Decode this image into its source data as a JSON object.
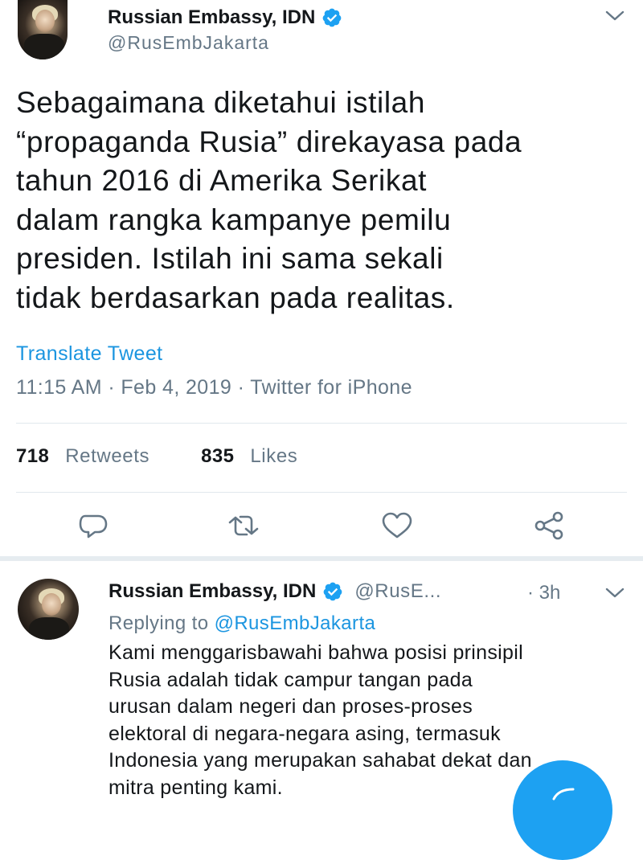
{
  "tweet": {
    "author_name": "Russian Embassy, IDN",
    "author_handle": "@RusEmbJakarta",
    "text_lines": [
      "Sebagaimana diketahui istilah",
      "“propaganda Rusia” direkayasa pada",
      "tahun 2016 di Amerika Serikat",
      "dalam rangka kampanye pemilu",
      "presiden. Istilah ini sama sekali",
      "tidak berdasarkan pada realitas."
    ],
    "translate_label": "Translate Tweet",
    "meta": "11:15 AM · Feb 4, 2019 · Twitter for iPhone",
    "retweet_count": "718",
    "retweet_label": "Retweets",
    "like_count": "835",
    "like_label": "Likes"
  },
  "reply": {
    "author_name": "Russian Embassy, IDN",
    "author_handle": "@RusE...",
    "time": "· 3h",
    "replying_prefix": "Replying to",
    "replying_handle": "@RusEmbJakarta",
    "text_lines": [
      "Kami menggarisbawahi bahwa posisi prinsipil",
      "Rusia adalah tidak campur tangan pada",
      "urusan dalam negeri dan proses-proses",
      "elektoral di negara-negara asing, termasuk",
      "Indonesia yang merupakan sahabat dekat dan",
      "mitra penting kami."
    ]
  },
  "icons": {
    "verified": "verified-badge-icon",
    "menu": "chevron-down-icon",
    "reply": "reply-icon",
    "retweet": "retweet-icon",
    "like": "heart-icon",
    "share": "share-icon",
    "compose": "compose-tweet-icon"
  },
  "colors": {
    "accent": "#1da1f2",
    "link": "#1b95e0",
    "secondary_text": "#657786",
    "divider": "#e1e8ed"
  }
}
